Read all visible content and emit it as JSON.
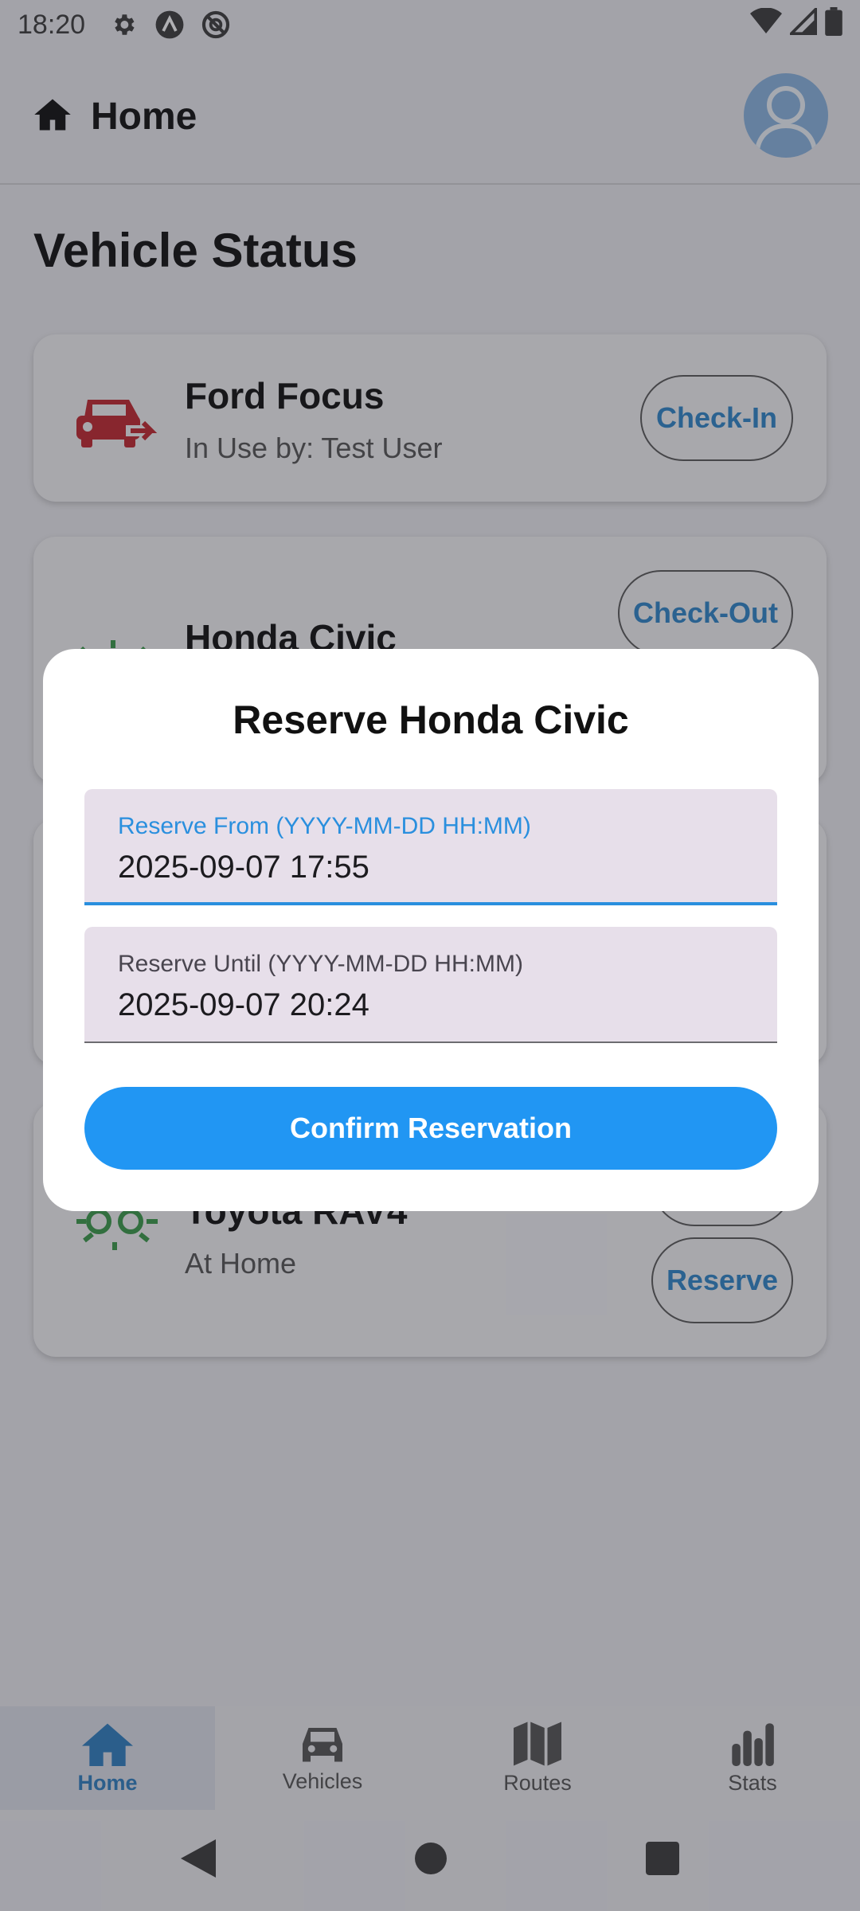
{
  "status_bar": {
    "time": "18:20"
  },
  "app_bar": {
    "title": "Home"
  },
  "page": {
    "title": "Vehicle Status"
  },
  "vehicles": [
    {
      "name": "Ford Focus",
      "status": "In Use by: Test User",
      "action": "Check-In",
      "icon_color": "#c0282f"
    },
    {
      "name": "Honda Civic",
      "action": "Check-Out",
      "icon_color": "#3a9a4a"
    },
    {
      "name": "Toyota RAV4",
      "status": "At Home",
      "action": "Reserve",
      "icon_color": "#3a9a4a"
    }
  ],
  "dialog": {
    "title": "Reserve Honda Civic",
    "from_label": "Reserve From (YYYY-MM-DD HH:MM)",
    "from_value": "2025-09-07 17:55",
    "until_label": "Reserve Until (YYYY-MM-DD HH:MM)",
    "until_value": "2025-09-07 20:24",
    "confirm_label": "Confirm Reservation"
  },
  "bottom_nav": [
    {
      "label": "Home",
      "icon": "home-icon",
      "active": true
    },
    {
      "label": "Vehicles",
      "icon": "car-icon",
      "active": false
    },
    {
      "label": "Routes",
      "icon": "map-icon",
      "active": false
    },
    {
      "label": "Stats",
      "icon": "bar-chart-icon",
      "active": false
    }
  ],
  "colors": {
    "accent": "#2196f3",
    "field_bg": "#e7dfea",
    "scrim": "rgba(35,35,45,0.36)"
  }
}
